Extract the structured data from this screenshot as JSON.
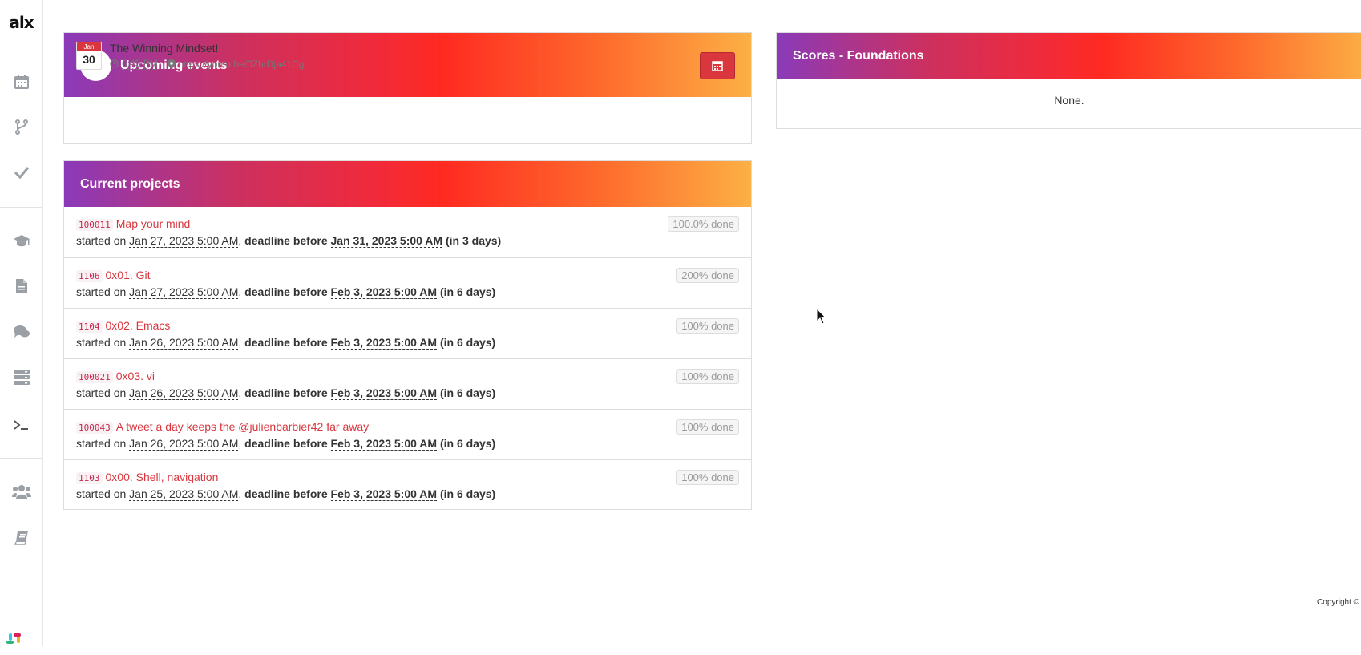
{
  "sidebar": {
    "logo": "alx",
    "items": [
      {
        "icon": "calendar-icon"
      },
      {
        "icon": "code-fork-icon"
      },
      {
        "icon": "check-icon"
      },
      {
        "icon": "graduation-cap-icon"
      },
      {
        "icon": "file-icon"
      },
      {
        "icon": "comments-icon"
      },
      {
        "icon": "server-icon"
      },
      {
        "icon": "terminal-icon"
      },
      {
        "icon": "users-icon"
      },
      {
        "icon": "book-icon"
      }
    ]
  },
  "events": {
    "title": "Upcoming events",
    "items": [
      {
        "month": "Jan",
        "day": "30",
        "title": "The Winning Mindset!",
        "time": "6:45 PM",
        "location": "https://youtu.be/0ZhrDja41Cg"
      }
    ]
  },
  "projects": {
    "title": "Current projects",
    "started_prefix": "started on",
    "deadline_prefix": "deadline before",
    "items": [
      {
        "code": "100011",
        "title": "Map your mind",
        "started": "Jan 27, 2023 5:00 AM",
        "deadline": "Jan 31, 2023 5:00 AM",
        "remaining": "(in 3 days)",
        "done": "100.0% done"
      },
      {
        "code": "1106",
        "title": "0x01. Git",
        "started": "Jan 27, 2023 5:00 AM",
        "deadline": "Feb 3, 2023 5:00 AM",
        "remaining": "(in 6 days)",
        "done": "200% done"
      },
      {
        "code": "1104",
        "title": "0x02. Emacs",
        "started": "Jan 26, 2023 5:00 AM",
        "deadline": "Feb 3, 2023 5:00 AM",
        "remaining": "(in 6 days)",
        "done": "100% done"
      },
      {
        "code": "100021",
        "title": "0x03. vi",
        "started": "Jan 26, 2023 5:00 AM",
        "deadline": "Feb 3, 2023 5:00 AM",
        "remaining": "(in 6 days)",
        "done": "100% done"
      },
      {
        "code": "100043",
        "title": "A tweet a day keeps the @julienbarbier42 far away",
        "started": "Jan 26, 2023 5:00 AM",
        "deadline": "Feb 3, 2023 5:00 AM",
        "remaining": "(in 6 days)",
        "done": "100% done"
      },
      {
        "code": "1103",
        "title": "0x00. Shell, navigation",
        "started": "Jan 25, 2023 5:00 AM",
        "deadline": "Feb 3, 2023 5:00 AM",
        "remaining": "(in 6 days)",
        "done": "100% done"
      }
    ]
  },
  "scores": {
    "title": "Scores - Foundations",
    "value": "None."
  },
  "footer": {
    "copyright": "Copyright ©"
  },
  "colors": {
    "accent": "#d9363e",
    "gradient_start": "#8a3ab9",
    "gradient_mid": "#ff2a21",
    "gradient_end": "#fcb045"
  }
}
